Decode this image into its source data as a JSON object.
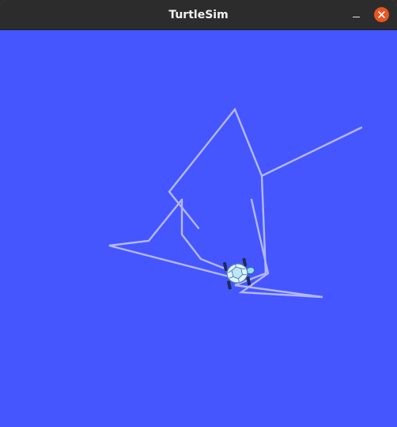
{
  "window": {
    "title": "TurtleSim"
  },
  "colors": {
    "background": "#4556ff",
    "pen": "#b3b8ff",
    "titlebar": "#2c2c2c",
    "close": "#e95420"
  },
  "icons": {
    "minimize": "minimize-icon",
    "close": "close-icon",
    "turtle": "turtle-icon"
  }
}
